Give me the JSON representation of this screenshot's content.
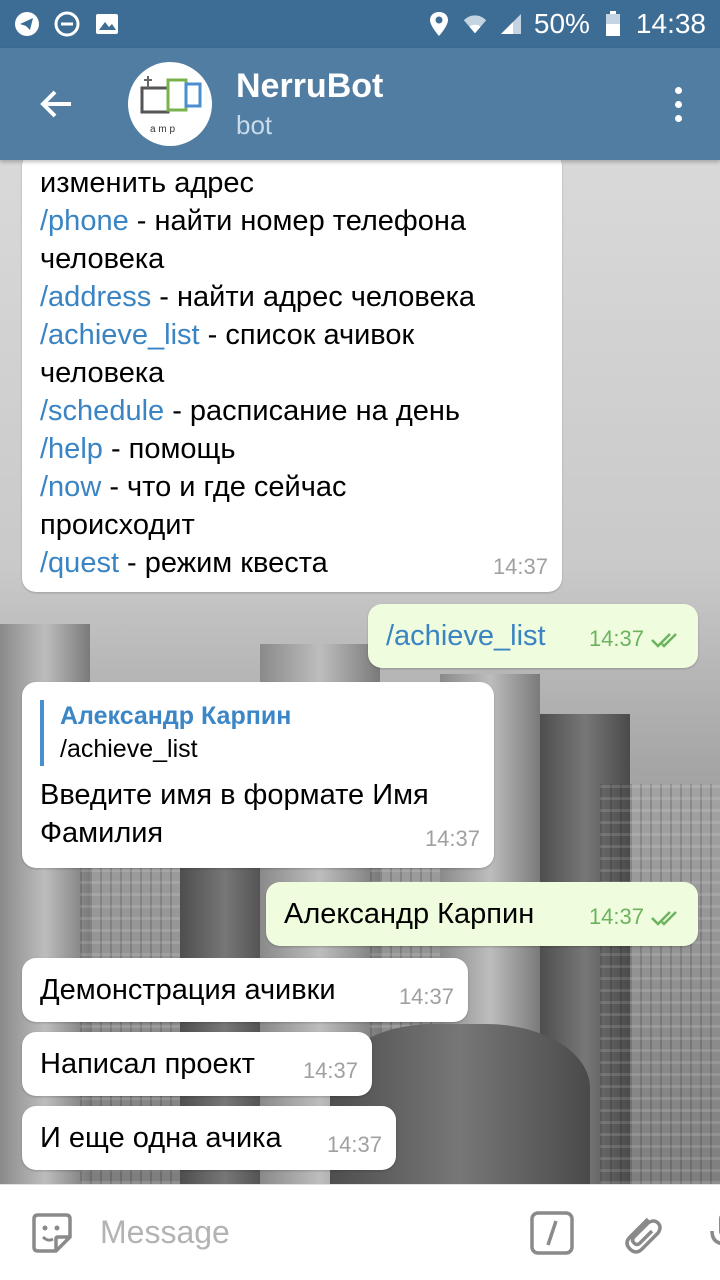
{
  "status_bar": {
    "battery": "50%",
    "time": "14:38"
  },
  "header": {
    "title": "NerruBot",
    "subtitle": "bot",
    "avatar_text": "a m p"
  },
  "messages": {
    "m1": {
      "l1": "изменить адрес",
      "l2_cmd": "/phone",
      "l2_text": " - найти номер телефона",
      "l3": "человека",
      "l4_cmd": "/address",
      "l4_text": " - найти адрес человека",
      "l5_cmd": "/achieve_list",
      "l5_text": " - список ачивок",
      "l6": "человека",
      "l7_cmd": "/schedule",
      "l7_text": " - расписание на день",
      "l8_cmd": "/help",
      "l8_text": " - помощь",
      "l9_cmd": "/now",
      "l9_text": " - что и где сейчас",
      "l10": "происходит",
      "l11_cmd": "/quest",
      "l11_text": " - режим квеста",
      "time": "14:37"
    },
    "m2": {
      "text": "/achieve_list",
      "time": "14:37"
    },
    "m3": {
      "reply_name": "Александр Карпин",
      "reply_text": "/achieve_list",
      "l1": "Введите имя в формате Имя",
      "l2": "Фамилия",
      "time": "14:37"
    },
    "m4": {
      "text": "Александр Карпин",
      "time": "14:37"
    },
    "m5": {
      "text": "Демонстрация ачивки",
      "time": "14:37"
    },
    "m6": {
      "text": "Написал проект",
      "time": "14:37"
    },
    "m7": {
      "text": "И еще одна ачика",
      "time": "14:37"
    }
  },
  "input": {
    "placeholder": "Message"
  },
  "colors": {
    "appbar": "#517da2",
    "statusbar": "#3d6c94",
    "command": "#3a84c3",
    "outgoing": "#effdde"
  }
}
